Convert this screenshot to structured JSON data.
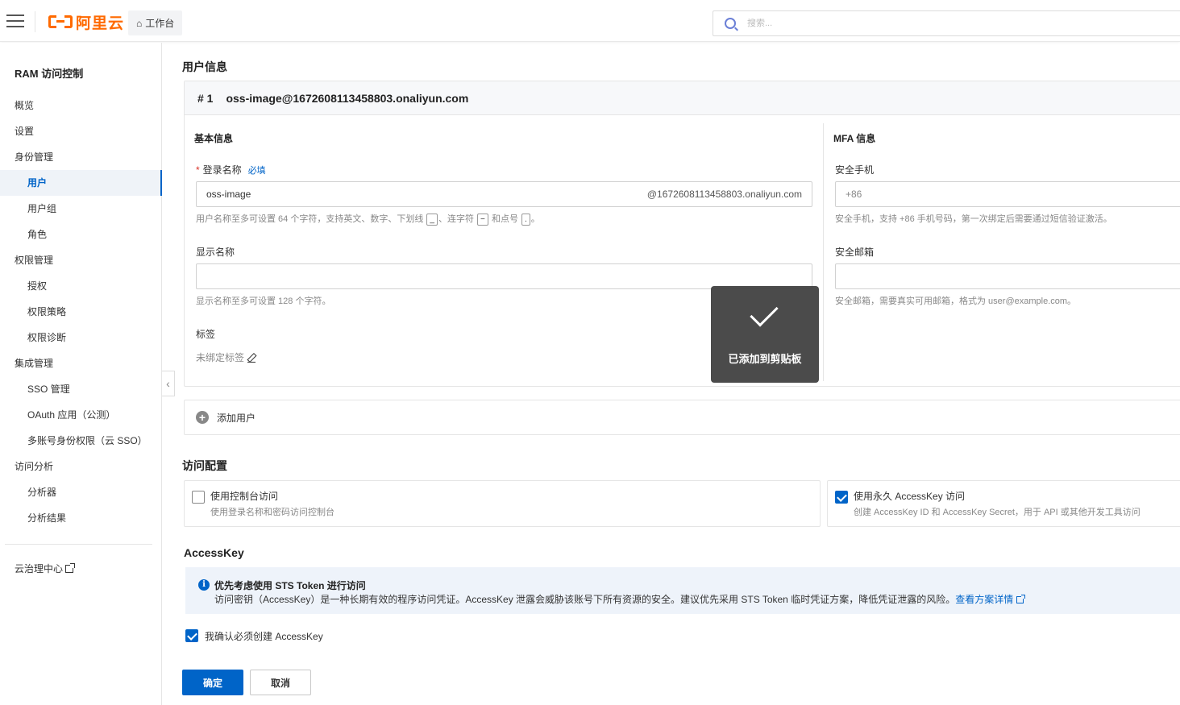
{
  "header": {
    "logo_text": "阿里云",
    "workbench_label": "工作台",
    "search_placeholder": "搜索..."
  },
  "sidebar": {
    "title": "RAM 访问控制",
    "items": [
      {
        "label": "概览",
        "level": 1
      },
      {
        "label": "设置",
        "level": 1
      },
      {
        "label": "身份管理",
        "level": 1
      },
      {
        "label": "用户",
        "level": 2,
        "active": true
      },
      {
        "label": "用户组",
        "level": 2
      },
      {
        "label": "角色",
        "level": 2
      },
      {
        "label": "权限管理",
        "level": 1
      },
      {
        "label": "授权",
        "level": 2
      },
      {
        "label": "权限策略",
        "level": 2
      },
      {
        "label": "权限诊断",
        "level": 2
      },
      {
        "label": "集成管理",
        "level": 1
      },
      {
        "label": "SSO 管理",
        "level": 2
      },
      {
        "label": "OAuth 应用（公测）",
        "level": 2
      },
      {
        "label": "多账号身份权限（云 SSO）",
        "level": 2
      },
      {
        "label": "访问分析",
        "level": 1
      },
      {
        "label": "分析器",
        "level": 2
      },
      {
        "label": "分析结果",
        "level": 2
      }
    ],
    "footer_link": "云治理中心"
  },
  "user_info": {
    "section_title": "用户信息",
    "card_index": "# 1",
    "card_email": "oss-image@1672608113458803.onaliyun.com",
    "basic": {
      "title": "基本信息",
      "login_name_label": "登录名称",
      "required_text": "必填",
      "login_name_value": "oss-image",
      "login_name_suffix": "@1672608113458803.onaliyun.com",
      "login_help_1": "用户名称至多可设置 64 个字符，支持英文、数字、下划线",
      "login_help_k1": "_",
      "login_help_2": "、连字符",
      "login_help_k2": "−",
      "login_help_3": "和点号",
      "login_help_k3": ".",
      "login_help_4": "。",
      "display_name_label": "显示名称",
      "display_name_value": "",
      "display_help": "显示名称至多可设置 128 个字符。",
      "tags_label": "标签",
      "tags_empty": "未绑定标签"
    },
    "mfa": {
      "title": "MFA 信息",
      "phone_label": "安全手机",
      "phone_placeholder": "+86",
      "phone_help": "安全手机，支持 +86 手机号码，第一次绑定后需要通过短信验证激活。",
      "email_label": "安全邮箱",
      "email_value": "",
      "email_help": "安全邮箱，需要真实可用邮箱，格式为 user@example.com。"
    },
    "toast_text": "已添加到剪贴板",
    "add_user_label": "添加用户"
  },
  "access": {
    "section_title": "访问配置",
    "console": {
      "title": "使用控制台访问",
      "desc": "使用登录名称和密码访问控制台",
      "checked": false
    },
    "accesskey": {
      "title": "使用永久 AccessKey 访问",
      "desc": "创建 AccessKey ID 和 AccessKey Secret，用于 API 或其他开发工具访问",
      "checked": true
    }
  },
  "accesskey_section": {
    "title": "AccessKey",
    "notice_title": "优先考虑使用 STS Token 进行访问",
    "notice_body": "访问密钥（AccessKey）是一种长期有效的程序访问凭证。AccessKey 泄露会威胁该账号下所有资源的安全。建议优先采用 STS Token 临时凭证方案，降低凭证泄露的风险。",
    "notice_link": "查看方案详情",
    "confirm_label": "我确认必须创建 AccessKey",
    "confirm_checked": true
  },
  "actions": {
    "ok_label": "确定",
    "cancel_label": "取消"
  },
  "colors": {
    "brand": "#ff6a00",
    "primary": "#0064c8"
  }
}
